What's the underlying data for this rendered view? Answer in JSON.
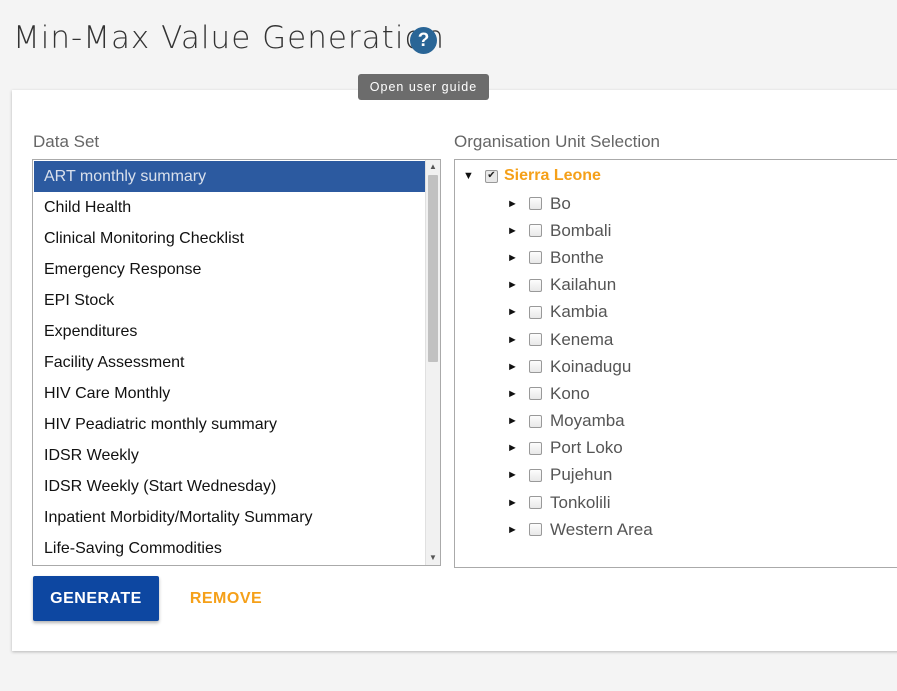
{
  "page": {
    "title": "Min-Max Value Generation",
    "help_icon": "question-mark-icon",
    "tooltip": "Open user guide"
  },
  "dataset": {
    "label": "Data Set",
    "selected_index": 0,
    "items": [
      "ART monthly summary",
      "Child Health",
      "Clinical Monitoring Checklist",
      "Emergency Response",
      "EPI Stock",
      "Expenditures",
      "Facility Assessment",
      "HIV Care Monthly",
      "HIV Peadiatric monthly summary",
      "IDSR Weekly",
      "IDSR Weekly (Start Wednesday)",
      "Inpatient Morbidity/Mortality Summary",
      "Life-Saving Commodities"
    ]
  },
  "org_units": {
    "label": "Organisation Unit Selection",
    "root": {
      "name": "Sierra Leone",
      "checked": true,
      "expanded": true
    },
    "children": [
      "Bo",
      "Bombali",
      "Bonthe",
      "Kailahun",
      "Kambia",
      "Kenema",
      "Koinadugu",
      "Kono",
      "Moyamba",
      "Port Loko",
      "Pujehun",
      "Tonkolili",
      "Western Area"
    ]
  },
  "actions": {
    "generate_label": "GENERATE",
    "remove_label": "REMOVE"
  },
  "colors": {
    "primary": "#0d47a1",
    "selected_row": "#2c5aa0",
    "accent": "#f5a019",
    "help": "#296596"
  }
}
